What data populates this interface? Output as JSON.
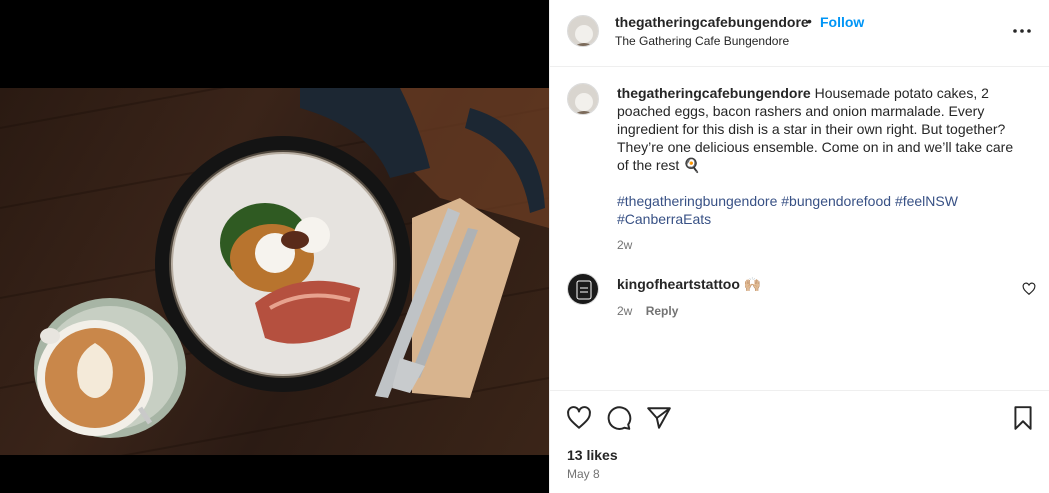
{
  "post": {
    "username": "thegatheringcafebungendore",
    "separator": "•",
    "follow_label": "Follow",
    "location": "The Gathering Cafe Bungendore",
    "more_icon": "more-options-icon"
  },
  "caption": {
    "username": "thegatheringcafebungendore",
    "text": "Housemade potato cakes, 2 poached eggs, bacon rashers and onion marmalade. Every ingredient for this dish is a star in their own right. But together? They’re one delicious ensemble. Come on in and we’ll take care of the rest 🍳",
    "hashtags": [
      "#thegatheringbungendore",
      "#bungendorefood",
      "#feelNSW",
      "#CanberraEats"
    ],
    "time": "2w"
  },
  "comments": [
    {
      "username": "kingofheartstattoo",
      "text": "🙌🏼",
      "time": "2w",
      "reply_label": "Reply"
    }
  ],
  "actions": {
    "like_icon": "heart-icon",
    "comment_icon": "comment-icon",
    "share_icon": "share-icon",
    "save_icon": "bookmark-icon"
  },
  "likes": "13 likes",
  "date": "May 8",
  "colors": {
    "link": "#0095f6",
    "hashtag": "#385185",
    "muted": "#737373",
    "text": "#262626"
  }
}
